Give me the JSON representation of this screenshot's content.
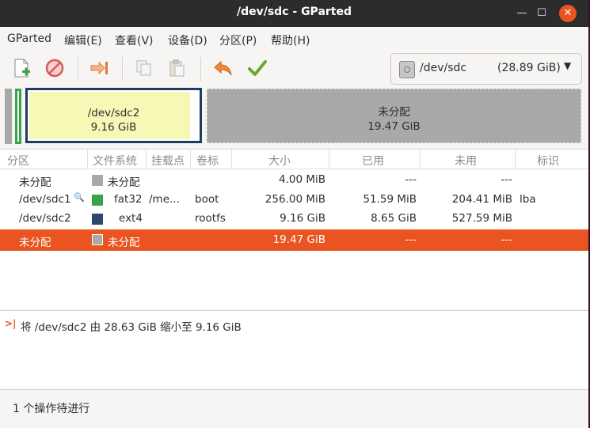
{
  "window": {
    "title": "/dev/sdc - GParted"
  },
  "menubar": {
    "items": [
      "GParted",
      "编辑(E)",
      "查看(V)",
      "设备(D)",
      "分区(P)",
      "帮助(H)"
    ]
  },
  "toolbar": {
    "buttons": [
      "new-icon",
      "delete-icon",
      "resize-move-icon",
      "copy-icon",
      "paste-icon",
      "undo-icon",
      "apply-icon"
    ],
    "device": {
      "name": "/dev/sdc",
      "size": "(28.89 GiB)"
    }
  },
  "diskmap": {
    "sdc2": {
      "name": "/dev/sdc2",
      "size": "9.16 GiB"
    },
    "unallocated": {
      "name": "未分配",
      "size": "19.47 GiB"
    }
  },
  "table": {
    "headers": [
      "分区",
      "文件系统",
      "挂载点",
      "卷标",
      "大小",
      "已用",
      "未用",
      "标识"
    ],
    "rows": [
      {
        "partition": "未分配",
        "fs_color": "#a9a9a9",
        "fs": "未分配",
        "mount": "",
        "label": "",
        "size": "4.00 MiB",
        "used": "---",
        "unused": "---",
        "flags": "",
        "selected": false
      },
      {
        "partition": "/dev/sdc1",
        "fs_color": "#3aa34a",
        "fs": "fat32",
        "mount": "/me...",
        "label": "boot",
        "size": "256.00 MiB",
        "used": "51.59 MiB",
        "unused": "204.41 MiB",
        "flags": "lba",
        "selected": false
      },
      {
        "partition": "/dev/sdc2",
        "fs_color": "#2b4a6b",
        "fs": "ext4",
        "mount": "",
        "label": "rootfs",
        "size": "9.16 GiB",
        "used": "8.65 GiB",
        "unused": "527.59 MiB",
        "flags": "",
        "selected": false
      },
      {
        "partition": "未分配",
        "fs_color": "#a9a9a9",
        "fs": "未分配",
        "mount": "",
        "label": "",
        "size": "19.47 GiB",
        "used": "---",
        "unused": "---",
        "flags": "",
        "selected": true
      }
    ]
  },
  "operations": {
    "items": [
      "将 /dev/sdc2 由 28.63 GiB 缩小至 9.16 GiB"
    ]
  },
  "status": {
    "text": "1 个操作待进行"
  },
  "colors": {
    "selection": "#e95420",
    "unallocated": "#a9a9a9",
    "ext4": "#2b4a6b",
    "fat32": "#3aa34a",
    "used_space": "#f7f7b6"
  }
}
